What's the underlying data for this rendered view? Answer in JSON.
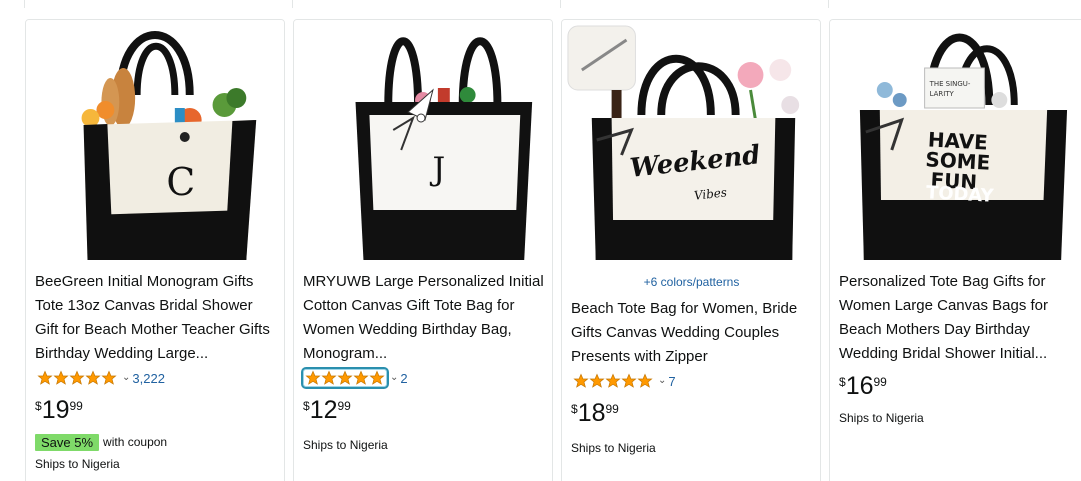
{
  "products": [
    {
      "title": "BeeGreen Initial Monogram Gifts Tote 13oz Canvas Bridal Shower Gift for Beach Mother Teacher Gifts Birthday Wedding Large...",
      "image_text": "C",
      "swatch_text": "",
      "rating_count": "3,222",
      "price_symbol": "$",
      "price_whole": "19",
      "price_fraction": "99",
      "coupon_badge": "Save 5%",
      "coupon_text": "with coupon",
      "shipping": "Ships to Nigeria"
    },
    {
      "title": "MRYUWB Large Personalized Initial Cotton Canvas Gift Tote Bag for Women Wedding Birthday Bag, Monogram...",
      "image_text": "J",
      "swatch_text": "",
      "rating_count": "2",
      "price_symbol": "$",
      "price_whole": "12",
      "price_fraction": "99",
      "shipping": "Ships to Nigeria"
    },
    {
      "title": "Beach Tote Bag for Women, Bride Gifts Canvas Wedding Couples Presents with Zipper",
      "image_text": "Weekend",
      "image_subtext": "Vibes",
      "swatch_text": "+6 colors/patterns",
      "rating_count": "7",
      "price_symbol": "$",
      "price_whole": "18",
      "price_fraction": "99",
      "shipping": "Ships to Nigeria"
    },
    {
      "title": "Personalized Tote Bag Gifts for Women Large Canvas Bags for Beach Mothers Day Birthday Wedding Bridal Shower Initial...",
      "image_text_lines": [
        "HAVE",
        "SOME",
        "FUN",
        "TODAY"
      ],
      "image_book_text": "THE SINGU-\nLARITY",
      "swatch_text": "",
      "price_symbol": "$",
      "price_whole": "16",
      "price_fraction": "99",
      "shipping": "Ships to Nigeria"
    }
  ],
  "colors": {
    "star": "#ff9900",
    "link": "#2162a1",
    "coupon_badge": "#7fda69",
    "focus_ring": "#2a8fae"
  },
  "icons": {
    "star": "star-icon",
    "chevron": "chevron-down-icon"
  }
}
